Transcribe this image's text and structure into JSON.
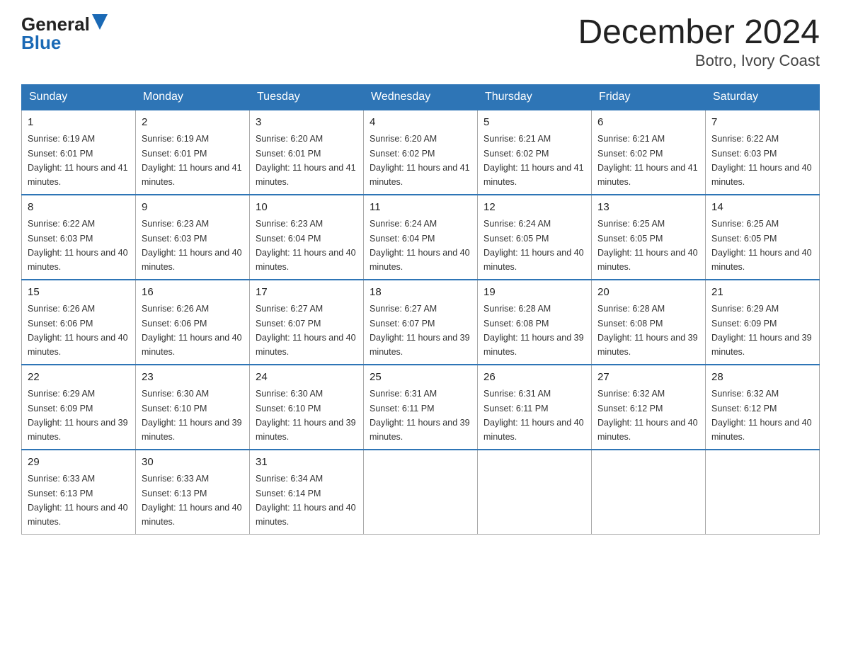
{
  "header": {
    "logo": {
      "general": "General",
      "blue": "Blue"
    },
    "title": "December 2024",
    "location": "Botro, Ivory Coast"
  },
  "days_of_week": [
    "Sunday",
    "Monday",
    "Tuesday",
    "Wednesday",
    "Thursday",
    "Friday",
    "Saturday"
  ],
  "weeks": [
    [
      {
        "day": "1",
        "sunrise": "6:19 AM",
        "sunset": "6:01 PM",
        "daylight": "11 hours and 41 minutes."
      },
      {
        "day": "2",
        "sunrise": "6:19 AM",
        "sunset": "6:01 PM",
        "daylight": "11 hours and 41 minutes."
      },
      {
        "day": "3",
        "sunrise": "6:20 AM",
        "sunset": "6:01 PM",
        "daylight": "11 hours and 41 minutes."
      },
      {
        "day": "4",
        "sunrise": "6:20 AM",
        "sunset": "6:02 PM",
        "daylight": "11 hours and 41 minutes."
      },
      {
        "day": "5",
        "sunrise": "6:21 AM",
        "sunset": "6:02 PM",
        "daylight": "11 hours and 41 minutes."
      },
      {
        "day": "6",
        "sunrise": "6:21 AM",
        "sunset": "6:02 PM",
        "daylight": "11 hours and 41 minutes."
      },
      {
        "day": "7",
        "sunrise": "6:22 AM",
        "sunset": "6:03 PM",
        "daylight": "11 hours and 40 minutes."
      }
    ],
    [
      {
        "day": "8",
        "sunrise": "6:22 AM",
        "sunset": "6:03 PM",
        "daylight": "11 hours and 40 minutes."
      },
      {
        "day": "9",
        "sunrise": "6:23 AM",
        "sunset": "6:03 PM",
        "daylight": "11 hours and 40 minutes."
      },
      {
        "day": "10",
        "sunrise": "6:23 AM",
        "sunset": "6:04 PM",
        "daylight": "11 hours and 40 minutes."
      },
      {
        "day": "11",
        "sunrise": "6:24 AM",
        "sunset": "6:04 PM",
        "daylight": "11 hours and 40 minutes."
      },
      {
        "day": "12",
        "sunrise": "6:24 AM",
        "sunset": "6:05 PM",
        "daylight": "11 hours and 40 minutes."
      },
      {
        "day": "13",
        "sunrise": "6:25 AM",
        "sunset": "6:05 PM",
        "daylight": "11 hours and 40 minutes."
      },
      {
        "day": "14",
        "sunrise": "6:25 AM",
        "sunset": "6:05 PM",
        "daylight": "11 hours and 40 minutes."
      }
    ],
    [
      {
        "day": "15",
        "sunrise": "6:26 AM",
        "sunset": "6:06 PM",
        "daylight": "11 hours and 40 minutes."
      },
      {
        "day": "16",
        "sunrise": "6:26 AM",
        "sunset": "6:06 PM",
        "daylight": "11 hours and 40 minutes."
      },
      {
        "day": "17",
        "sunrise": "6:27 AM",
        "sunset": "6:07 PM",
        "daylight": "11 hours and 40 minutes."
      },
      {
        "day": "18",
        "sunrise": "6:27 AM",
        "sunset": "6:07 PM",
        "daylight": "11 hours and 39 minutes."
      },
      {
        "day": "19",
        "sunrise": "6:28 AM",
        "sunset": "6:08 PM",
        "daylight": "11 hours and 39 minutes."
      },
      {
        "day": "20",
        "sunrise": "6:28 AM",
        "sunset": "6:08 PM",
        "daylight": "11 hours and 39 minutes."
      },
      {
        "day": "21",
        "sunrise": "6:29 AM",
        "sunset": "6:09 PM",
        "daylight": "11 hours and 39 minutes."
      }
    ],
    [
      {
        "day": "22",
        "sunrise": "6:29 AM",
        "sunset": "6:09 PM",
        "daylight": "11 hours and 39 minutes."
      },
      {
        "day": "23",
        "sunrise": "6:30 AM",
        "sunset": "6:10 PM",
        "daylight": "11 hours and 39 minutes."
      },
      {
        "day": "24",
        "sunrise": "6:30 AM",
        "sunset": "6:10 PM",
        "daylight": "11 hours and 39 minutes."
      },
      {
        "day": "25",
        "sunrise": "6:31 AM",
        "sunset": "6:11 PM",
        "daylight": "11 hours and 39 minutes."
      },
      {
        "day": "26",
        "sunrise": "6:31 AM",
        "sunset": "6:11 PM",
        "daylight": "11 hours and 40 minutes."
      },
      {
        "day": "27",
        "sunrise": "6:32 AM",
        "sunset": "6:12 PM",
        "daylight": "11 hours and 40 minutes."
      },
      {
        "day": "28",
        "sunrise": "6:32 AM",
        "sunset": "6:12 PM",
        "daylight": "11 hours and 40 minutes."
      }
    ],
    [
      {
        "day": "29",
        "sunrise": "6:33 AM",
        "sunset": "6:13 PM",
        "daylight": "11 hours and 40 minutes."
      },
      {
        "day": "30",
        "sunrise": "6:33 AM",
        "sunset": "6:13 PM",
        "daylight": "11 hours and 40 minutes."
      },
      {
        "day": "31",
        "sunrise": "6:34 AM",
        "sunset": "6:14 PM",
        "daylight": "11 hours and 40 minutes."
      },
      null,
      null,
      null,
      null
    ]
  ]
}
